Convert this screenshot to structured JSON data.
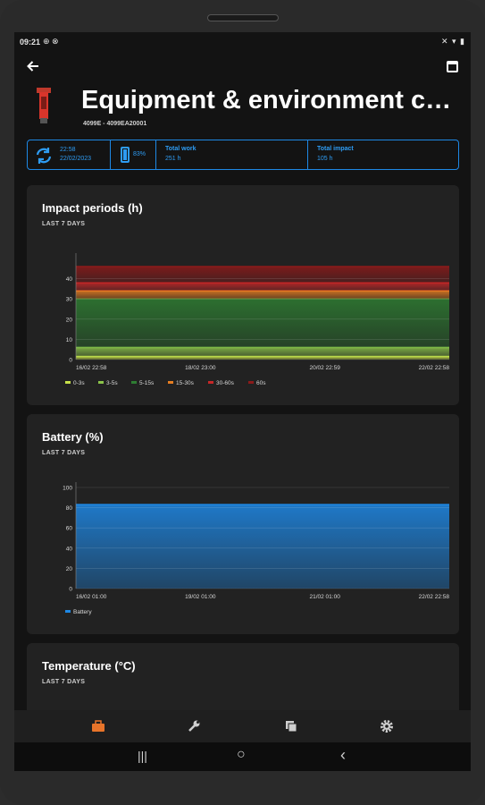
{
  "status_bar": {
    "time": "09:21",
    "left_icons": "⊕ ⊗",
    "right_icons": "✕ ▾ ▮"
  },
  "app_bar": {
    "back_icon": "arrow-left-icon",
    "calendar_icon": "calendar-icon"
  },
  "header": {
    "title": "Equipment & environment co...",
    "subtitle": "4099E - 4099EA20001"
  },
  "info_bar": {
    "sync_time": "22:58",
    "sync_date": "22/02/2023",
    "battery": "83%",
    "battery_level": 0.83,
    "total_work_label": "Total work",
    "total_work_value": "251 h",
    "total_impact_label": "Total impact",
    "total_impact_value": "105 h"
  },
  "cards": {
    "impact": {
      "title": "Impact periods  (h)",
      "subtitle": "LAST 7 DAYS"
    },
    "battery": {
      "title": "Battery  (%)",
      "subtitle": "LAST 7 DAYS"
    },
    "temperature": {
      "title": "Temperature  (°C)",
      "subtitle": "LAST 7 DAYS"
    }
  },
  "chart_data": [
    {
      "type": "area",
      "title": "Impact periods  (h)",
      "subtitle": "LAST 7 DAYS",
      "x_tick_labels": [
        "16/02 22:58",
        "18/02 23:00",
        "20/02 22:59",
        "22/02 22:58"
      ],
      "y_ticks": [
        0,
        10,
        20,
        30,
        40
      ],
      "ylim": [
        0,
        50
      ],
      "stacked": true,
      "series": [
        {
          "name": "0-3s",
          "color": "#c6e04a",
          "value": 1.5
        },
        {
          "name": "3-5s",
          "color": "#8bc34a",
          "value": 4.5
        },
        {
          "name": "5-15s",
          "color": "#2e7d32",
          "value": 24
        },
        {
          "name": "15-30s",
          "color": "#e67e22",
          "value": 4
        },
        {
          "name": "30-60s",
          "color": "#c62828",
          "value": 4
        },
        {
          "name": "60s",
          "color": "#8b1a1a",
          "value": 8
        }
      ],
      "legend_position": "bottom-left",
      "grid": true
    },
    {
      "type": "area",
      "title": "Battery  (%)",
      "subtitle": "LAST 7 DAYS",
      "x_tick_labels": [
        "16/02 01:00",
        "19/02 01:00",
        "21/02 01:00",
        "22/02 22:58"
      ],
      "y_ticks": [
        0,
        20,
        40,
        60,
        80,
        100
      ],
      "ylim": [
        0,
        100
      ],
      "series": [
        {
          "name": "Battery",
          "color": "#1e88e5",
          "value": 83
        }
      ],
      "legend_position": "bottom-left",
      "grid": true
    }
  ],
  "bottom_nav": {
    "items": [
      "product-icon",
      "wrench-icon",
      "copy-icon",
      "settings-icon"
    ],
    "active_color": "#e8742a"
  },
  "system_nav": {
    "recents": "|||",
    "home": "○",
    "back": "‹"
  }
}
